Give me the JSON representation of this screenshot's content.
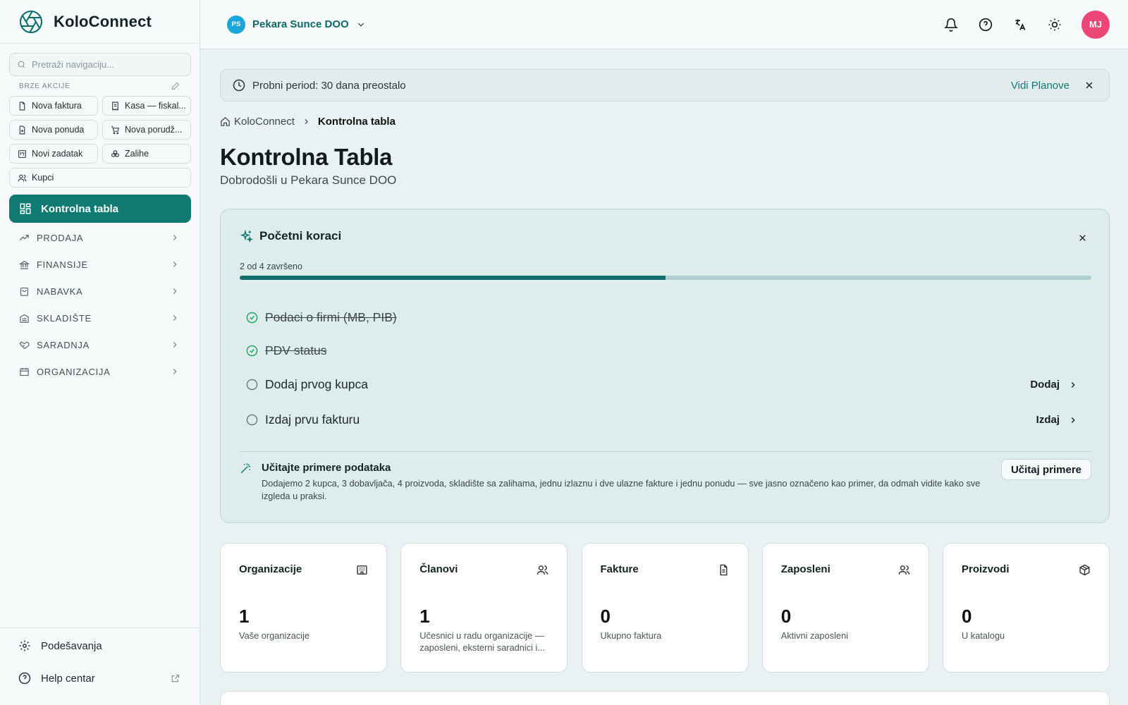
{
  "app": {
    "name": "KoloConnect"
  },
  "sidebar": {
    "search_placeholder": "Pretraži navigaciju...",
    "quick_actions_title": "BRZE AKCIJE",
    "quick_actions": [
      {
        "label": "Nova faktura",
        "icon": "file-icon"
      },
      {
        "label": "Kasa — fiskal...",
        "icon": "receipt-icon"
      },
      {
        "label": "Nova ponuda",
        "icon": "file-plus-icon"
      },
      {
        "label": "Nova porudž...",
        "icon": "cart-icon"
      },
      {
        "label": "Novi zadatak",
        "icon": "kanban-icon"
      },
      {
        "label": "Zalihe",
        "icon": "boxes-icon"
      },
      {
        "label": "Kupci",
        "icon": "users-icon"
      }
    ],
    "active_item": "Kontrolna tabla",
    "nav": [
      {
        "label": "PRODAJA",
        "icon": "trending-up-icon"
      },
      {
        "label": "FINANSIJE",
        "icon": "bank-icon"
      },
      {
        "label": "NABAVKA",
        "icon": "shopping-bag-icon"
      },
      {
        "label": "SKLADIŠTE",
        "icon": "warehouse-icon"
      },
      {
        "label": "SARADNJA",
        "icon": "handshake-icon"
      },
      {
        "label": "ORGANIZACIJA",
        "icon": "calendar-icon"
      }
    ],
    "footer": [
      {
        "label": "Podešavanja",
        "icon": "gear-icon"
      },
      {
        "label": "Help centar",
        "icon": "help-icon"
      }
    ]
  },
  "topbar": {
    "org_initials": "PS",
    "org_name": "Pekara Sunce DOO",
    "user_initials": "MJ"
  },
  "trial": {
    "message": "Probni period: 30 dana preostalo",
    "link": "Vidi Planove"
  },
  "breadcrumb": {
    "root": "KoloConnect",
    "current": "Kontrolna tabla"
  },
  "page": {
    "title": "Kontrolna Tabla",
    "subtitle": "Dobrodošli u Pekara Sunce DOO"
  },
  "onboarding": {
    "title": "Početni koraci",
    "progress_label": "2 od 4 završeno",
    "progress": 0.5,
    "steps": [
      {
        "label": "Podaci o firmi (MB, PIB)",
        "done": true,
        "action": ""
      },
      {
        "label": "PDV status",
        "done": true,
        "action": ""
      },
      {
        "label": "Dodaj prvog kupca",
        "done": false,
        "action": "Dodaj"
      },
      {
        "label": "Izdaj prvu fakturu",
        "done": false,
        "action": "Izdaj"
      }
    ],
    "sample": {
      "title": "Učitajte primere podataka",
      "description": "Dodajemo 2 kupca, 3 dobavljača, 4 proizvoda, skladište sa zalihama, jednu izlaznu i dve ulazne fakture i jednu ponudu — sve jasno označeno kao primer, da odmah vidite kako sve izgleda u praksi.",
      "button": "Učitaj primere"
    }
  },
  "stats": [
    {
      "title": "Organizacije",
      "value": "1",
      "sub": "Vaše organizacije",
      "icon": "building-icon"
    },
    {
      "title": "Članovi",
      "value": "1",
      "sub": "Učesnici u radu organizacije — zaposleni, eksterni saradnici i...",
      "icon": "users-icon"
    },
    {
      "title": "Fakture",
      "value": "0",
      "sub": "Ukupno faktura",
      "icon": "file-text-icon"
    },
    {
      "title": "Zaposleni",
      "value": "0",
      "sub": "Aktivni zaposleni",
      "icon": "users-icon"
    },
    {
      "title": "Proizvodi",
      "value": "0",
      "sub": "U katalogu",
      "icon": "package-icon"
    }
  ],
  "colors": {
    "accent": "#0e7a72",
    "avatar_user": "#ec4676",
    "avatar_org": "#1aa6d8"
  }
}
